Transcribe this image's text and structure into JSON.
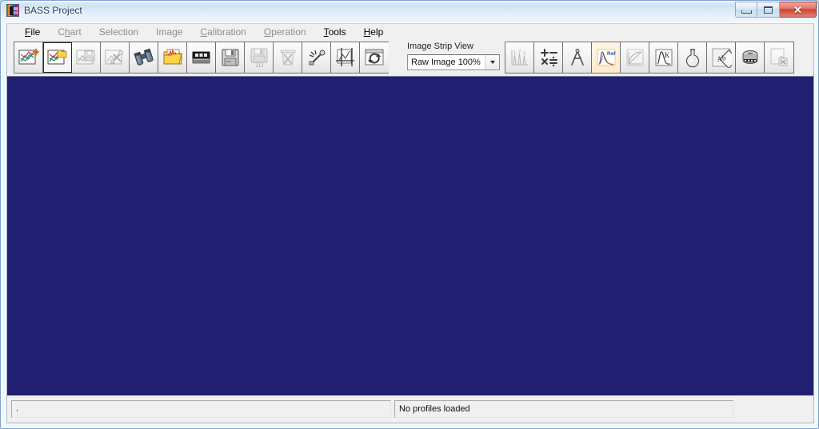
{
  "window": {
    "title": "BASS Project",
    "app_icon": "bass-logo-icon",
    "buttons": {
      "minimize": "minimize-icon",
      "maximize": "maximize-icon",
      "close": "✕"
    }
  },
  "menubar": {
    "items": [
      {
        "label": "File",
        "accel": "F",
        "disabled": false
      },
      {
        "label": "Chart",
        "accel": "h",
        "disabled": true
      },
      {
        "label": "Selection",
        "accel": "",
        "disabled": true
      },
      {
        "label": "Image",
        "accel": "",
        "disabled": true
      },
      {
        "label": "Calibration",
        "accel": "C",
        "disabled": true
      },
      {
        "label": "Operation",
        "accel": "O",
        "disabled": true
      },
      {
        "label": "Tools",
        "accel": "T",
        "disabled": false
      },
      {
        "label": "Help",
        "accel": "H",
        "disabled": false
      }
    ]
  },
  "toolbar": {
    "group_left": [
      {
        "name": "new-project-button",
        "icon": "chart-new-icon",
        "state": "enabled"
      },
      {
        "name": "open-project-button",
        "icon": "chart-folder-icon",
        "state": "selected"
      },
      {
        "name": "save-project-button",
        "icon": "chart-save-icon",
        "state": "disabled"
      },
      {
        "name": "project-settings-button",
        "icon": "chart-tools-icon",
        "state": "disabled"
      },
      {
        "name": "browse-button",
        "icon": "binoculars-icon",
        "state": "enabled"
      },
      {
        "name": "open-spectrum-button",
        "icon": "folder-spectrum-icon",
        "state": "enabled"
      },
      {
        "name": "image-strip-button",
        "icon": "film-strip-icon",
        "state": "enabled"
      },
      {
        "name": "save-button",
        "icon": "floppy-icon",
        "state": "enabled"
      },
      {
        "name": "save-1d-button",
        "icon": "floppy-1d-icon",
        "state": "disabled"
      },
      {
        "name": "delete-button",
        "icon": "trash-icon",
        "state": "disabled"
      },
      {
        "name": "repair-button",
        "icon": "wrench-spark-icon",
        "state": "enabled"
      },
      {
        "name": "crop-region-button",
        "icon": "crop-chart-icon",
        "state": "enabled"
      },
      {
        "name": "refresh-button",
        "icon": "refresh-icon",
        "state": "enabled"
      }
    ],
    "group_right": [
      {
        "name": "peak-numbering-button",
        "icon": "peak-numbers-icon",
        "state": "disabled"
      },
      {
        "name": "arithmetic-button",
        "icon": "math-operators-icon",
        "state": "enabled"
      },
      {
        "name": "divider-compass-button",
        "icon": "compass-divider-icon",
        "state": "enabled"
      },
      {
        "name": "reference-spectrum-button",
        "icon": "ref-spectrum-icon",
        "state": "hot"
      },
      {
        "name": "integration-button",
        "icon": "curve-protractor-icon",
        "state": "disabled"
      },
      {
        "name": "kinetics-button",
        "icon": "peak-k-icon",
        "state": "enabled"
      },
      {
        "name": "concentration-button",
        "icon": "flask-icon",
        "state": "enabled"
      },
      {
        "name": "absorbance-button",
        "icon": "ab-diamond-icon",
        "state": "enabled"
      },
      {
        "name": "movie-button",
        "icon": "film-reel-icon",
        "state": "enabled"
      },
      {
        "name": "close-document-button",
        "icon": "document-close-icon",
        "state": "disabled"
      }
    ],
    "strip_view": {
      "label": "Image Strip View",
      "selected": "Raw Image 100%",
      "options": [
        "Raw Image 100%"
      ]
    }
  },
  "statusbar": {
    "left": ",",
    "right": "No profiles loaded"
  },
  "colors": {
    "client_background": "#211f72",
    "chrome": "#f0f0f0",
    "title_text": "#14385e",
    "close_button": "#cd4434",
    "accent_hot": "#ffe9cc"
  }
}
